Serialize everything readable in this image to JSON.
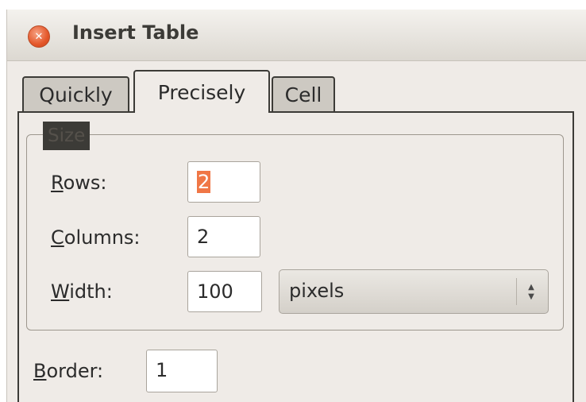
{
  "window": {
    "title": "Insert Table"
  },
  "tabs": [
    {
      "label": "Quickly",
      "active": false
    },
    {
      "label": "Precisely",
      "active": true
    },
    {
      "label": "Cell",
      "active": false
    }
  ],
  "size_group": {
    "title": "Size",
    "rows": {
      "mnemonic": "R",
      "label_rest": "ows:",
      "value": "2"
    },
    "columns": {
      "mnemonic": "C",
      "label_rest": "olumns:",
      "value": "2"
    },
    "width": {
      "mnemonic": "W",
      "label_rest": "idth:",
      "value": "100",
      "unit": "pixels"
    }
  },
  "border": {
    "mnemonic": "B",
    "label_rest": "order:",
    "value": "1"
  },
  "colors": {
    "selection": "#f07746",
    "close_button": "#e4572a",
    "window_bg": "#efebe7"
  },
  "icons": {
    "close": "close-icon",
    "combo_arrows": "updown-arrows-icon"
  }
}
